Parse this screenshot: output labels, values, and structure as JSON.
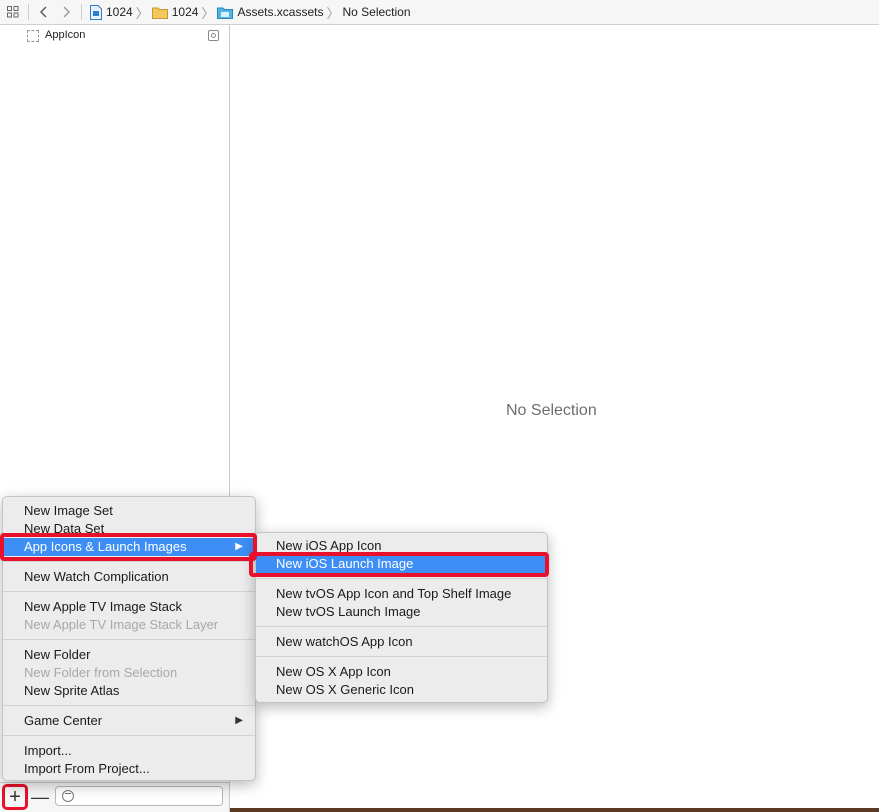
{
  "breadcrumb": [
    {
      "label": "1024",
      "icon": "project-file-icon"
    },
    {
      "label": "1024",
      "icon": "folder-icon"
    },
    {
      "label": "Assets.xcassets",
      "icon": "asset-catalog-icon"
    },
    {
      "label": "No Selection",
      "icon": ""
    }
  ],
  "sidebar": {
    "items": [
      {
        "label": "AppIcon"
      }
    ]
  },
  "main": {
    "empty_label": "No Selection"
  },
  "bottombar": {
    "add_label": "+",
    "remove_label": "—",
    "filter_placeholder": ""
  },
  "add_menu": {
    "items": [
      {
        "label": "New Image Set",
        "state": "normal"
      },
      {
        "label": "New Data Set",
        "state": "normal"
      },
      {
        "label": "App Icons & Launch Images",
        "state": "highlight",
        "submenu": true
      },
      {
        "label": "New Watch Complication",
        "state": "normal"
      },
      {
        "label": "New Apple TV Image Stack",
        "state": "normal"
      },
      {
        "label": "New Apple TV Image Stack Layer",
        "state": "disabled"
      },
      {
        "label": "New Folder",
        "state": "normal"
      },
      {
        "label": "New Folder from Selection",
        "state": "disabled"
      },
      {
        "label": "New Sprite Atlas",
        "state": "normal"
      },
      {
        "label": "Game Center",
        "state": "normal",
        "submenu": true
      },
      {
        "label": "Import...",
        "state": "normal"
      },
      {
        "label": "Import From Project...",
        "state": "normal"
      }
    ],
    "submenu_arrow": "▶"
  },
  "app_icons_submenu": {
    "items": [
      {
        "label": "New iOS App Icon",
        "state": "normal"
      },
      {
        "label": "New iOS Launch Image",
        "state": "highlight"
      },
      {
        "label": "New tvOS App Icon and Top Shelf Image",
        "state": "normal"
      },
      {
        "label": "New tvOS Launch Image",
        "state": "normal"
      },
      {
        "label": "New watchOS App Icon",
        "state": "normal"
      },
      {
        "label": "New OS X App Icon",
        "state": "normal"
      },
      {
        "label": "New OS X Generic Icon",
        "state": "normal"
      }
    ]
  },
  "colors": {
    "highlight": "#3d8ff5",
    "annotation": "#e8102a"
  }
}
